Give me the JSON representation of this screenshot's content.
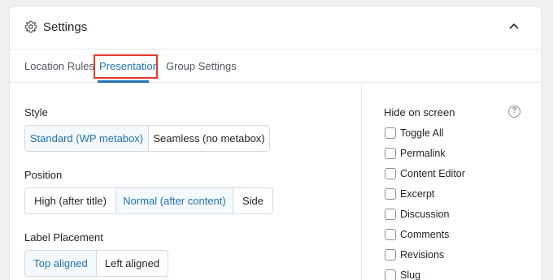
{
  "header": {
    "title": "Settings",
    "icon": "gear-icon",
    "collapse_icon": "chevron-up-icon"
  },
  "tabs": [
    {
      "label": "Location Rules",
      "active": false
    },
    {
      "label": "Presentation",
      "active": true
    },
    {
      "label": "Group Settings",
      "active": false
    }
  ],
  "style": {
    "label": "Style",
    "options": [
      "Standard (WP metabox)",
      "Seamless (no metabox)"
    ],
    "selected": "Standard (WP metabox)"
  },
  "position": {
    "label": "Position",
    "options": [
      "High (after title)",
      "Normal (after content)",
      "Side"
    ],
    "selected": "Normal (after content)"
  },
  "label_placement": {
    "label": "Label Placement",
    "options": [
      "Top aligned",
      "Left aligned"
    ],
    "selected": "Top aligned"
  },
  "hide_on_screen": {
    "label": "Hide on screen",
    "help_icon": "help-icon",
    "help_glyph": "?",
    "items": [
      {
        "label": "Toggle All",
        "checked": false
      },
      {
        "label": "Permalink",
        "checked": false
      },
      {
        "label": "Content Editor",
        "checked": false
      },
      {
        "label": "Excerpt",
        "checked": false
      },
      {
        "label": "Discussion",
        "checked": false
      },
      {
        "label": "Comments",
        "checked": false
      },
      {
        "label": "Revisions",
        "checked": false
      },
      {
        "label": "Slug",
        "checked": false
      }
    ]
  },
  "colors": {
    "accent": "#2271b1",
    "highlight_box": "#e53b2c",
    "selected_bg": "#f4f9fd"
  }
}
